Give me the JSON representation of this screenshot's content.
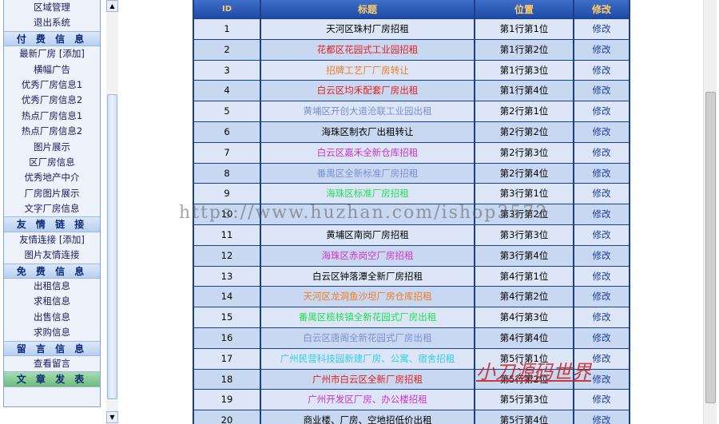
{
  "menu": {
    "items": [
      {
        "label": "区域管理",
        "type": "item"
      },
      {
        "label": "退出系统",
        "type": "item"
      },
      {
        "label": "付 费 信 息",
        "type": "head"
      },
      {
        "label": "最新厂房 [添加]",
        "type": "item"
      },
      {
        "label": "横幅广告",
        "type": "item"
      },
      {
        "label": "优秀厂房信息1",
        "type": "item"
      },
      {
        "label": "优秀厂房信息2",
        "type": "item"
      },
      {
        "label": "热点厂房信息1",
        "type": "item"
      },
      {
        "label": "热点厂房信息2",
        "type": "item"
      },
      {
        "label": "图片展示",
        "type": "item"
      },
      {
        "label": "区厂房信息",
        "type": "item"
      },
      {
        "label": "优秀地产中介",
        "type": "item"
      },
      {
        "label": "厂房图片展示",
        "type": "item"
      },
      {
        "label": "文字厂房信息",
        "type": "item"
      },
      {
        "label": "友 情 链 接",
        "type": "head"
      },
      {
        "label": "友情连接 [添加]",
        "type": "item"
      },
      {
        "label": "图片友情连接",
        "type": "item"
      },
      {
        "label": "免 费 信 息",
        "type": "head"
      },
      {
        "label": "出租信息",
        "type": "item"
      },
      {
        "label": "求租信息",
        "type": "item"
      },
      {
        "label": "出售信息",
        "type": "item"
      },
      {
        "label": "求购信息",
        "type": "item"
      },
      {
        "label": "留 言 信 息",
        "type": "head"
      },
      {
        "label": "查看留言",
        "type": "item"
      },
      {
        "label": "文 章 发 表",
        "type": "head-green"
      }
    ]
  },
  "left_scrollbar": {
    "up_icon": "▲",
    "down_icon": "▼"
  },
  "table": {
    "headers": {
      "id": "ID",
      "title": "标题",
      "position": "位置",
      "edit": "修改"
    },
    "rows": [
      {
        "id": "1",
        "title": "天河区珠村厂房招租",
        "color": "#000000",
        "position": "第1行第1位",
        "edit": "修改"
      },
      {
        "id": "2",
        "title": "花都区花园式工业园招租",
        "color": "#e0201e",
        "position": "第1行第2位",
        "edit": "修改"
      },
      {
        "id": "3",
        "title": "招牌工艺厂厂房转让",
        "color": "#f07a22",
        "position": "第1行第3位",
        "edit": "修改"
      },
      {
        "id": "4",
        "title": "白云区均禾配套厂房出租",
        "color": "#e0201e",
        "position": "第1行第4位",
        "edit": "修改"
      },
      {
        "id": "5",
        "title": "黄埔区开创大道沧联工业园出租",
        "color": "#7a8fd0",
        "position": "第2行第1位",
        "edit": "修改"
      },
      {
        "id": "6",
        "title": "海珠区制衣厂出租转让",
        "color": "#000000",
        "position": "第2行第2位",
        "edit": "修改"
      },
      {
        "id": "7",
        "title": "白云区嘉禾全新仓库招租",
        "color": "#cc33cc",
        "position": "第2行第3位",
        "edit": "修改"
      },
      {
        "id": "8",
        "title": "番禺区全新标准厂房招租",
        "color": "#7a8fd0",
        "position": "第2行第4位",
        "edit": "修改"
      },
      {
        "id": "9",
        "title": "海珠区标准厂房招租",
        "color": "#22dd55",
        "position": "第3行第1位",
        "edit": "修改"
      },
      {
        "id": "10",
        "title": "",
        "color": "#000000",
        "position": "第3行第2位",
        "edit": "修改"
      },
      {
        "id": "11",
        "title": "黄埔区南岗厂房招租",
        "color": "#000000",
        "position": "第3行第3位",
        "edit": "修改"
      },
      {
        "id": "12",
        "title": "海珠区赤岗空厂房招租",
        "color": "#cc33cc",
        "position": "第3行第4位",
        "edit": "修改"
      },
      {
        "id": "13",
        "title": "白云区钟落潭全新厂房招租",
        "color": "#000000",
        "position": "第4行第1位",
        "edit": "修改"
      },
      {
        "id": "14",
        "title": "天河区龙洞鱼沙坦厂房仓库招租",
        "color": "#f07a22",
        "position": "第4行第2位",
        "edit": "修改"
      },
      {
        "id": "15",
        "title": "番禺区榄核镇全新花园式厂房出租",
        "color": "#22dd55",
        "position": "第4行第3位",
        "edit": "修改"
      },
      {
        "id": "16",
        "title": "白云区唐阁全新花园式厂房出租",
        "color": "#7a8fd0",
        "position": "第4行第4位",
        "edit": "修改"
      },
      {
        "id": "17",
        "title": "广州民营科技园新建厂房、公寓、宿舍招租",
        "color": "#33ccee",
        "position": "第5行第1位",
        "edit": "修改"
      },
      {
        "id": "18",
        "title": "广州市白云区全新厂房招租",
        "color": "#e0201e",
        "position": "第5行第2位",
        "edit": "修改"
      },
      {
        "id": "19",
        "title": "广州开发区厂房、办公楼招租",
        "color": "#cc33cc",
        "position": "第5行第3位",
        "edit": "修改"
      },
      {
        "id": "20",
        "title": "商业楼、厂房、空地招低价出租",
        "color": "#000000",
        "position": "第5行第4位",
        "edit": "修改"
      }
    ]
  },
  "watermarks": {
    "url": "https://www.huzhan.com/ishop3572",
    "brand": "小刀源码世界"
  }
}
